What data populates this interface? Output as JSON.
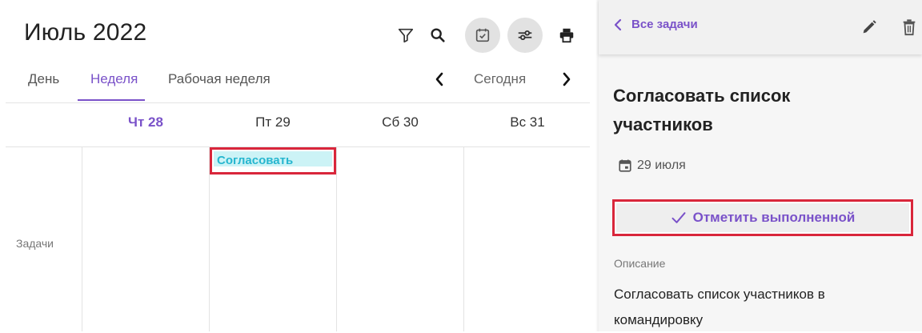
{
  "calendar": {
    "title": "Июль 2022",
    "toolbar": {
      "icons": [
        "filter-icon",
        "search-icon",
        "task-calendar-icon",
        "settings-sliders-icon",
        "print-icon"
      ]
    },
    "views": [
      {
        "label": "День",
        "active": false
      },
      {
        "label": "Неделя",
        "active": true
      },
      {
        "label": "Рабочая неделя",
        "active": false
      }
    ],
    "today_label": "Сегодня",
    "days": [
      {
        "label": "Чт 28",
        "is_today": true
      },
      {
        "label": "Пт 29",
        "is_today": false
      },
      {
        "label": "Сб 30",
        "is_today": false
      },
      {
        "label": "Вс 31",
        "is_today": false
      }
    ],
    "row_label": "Задачи",
    "event": {
      "text": "Согласовать",
      "day": "Пт 29"
    },
    "colors": {
      "accent": "#7a52c9",
      "event_bg": "#ccf3f6",
      "event_text": "#26b6cf",
      "highlight": "#d9263b"
    }
  },
  "panel": {
    "back_label": "Все задачи",
    "task_title": "Согласовать список участников",
    "date": "29 июля",
    "complete_label": "Отметить выполненной",
    "description_label": "Описание",
    "description": "Согласовать список участников в командировку"
  }
}
